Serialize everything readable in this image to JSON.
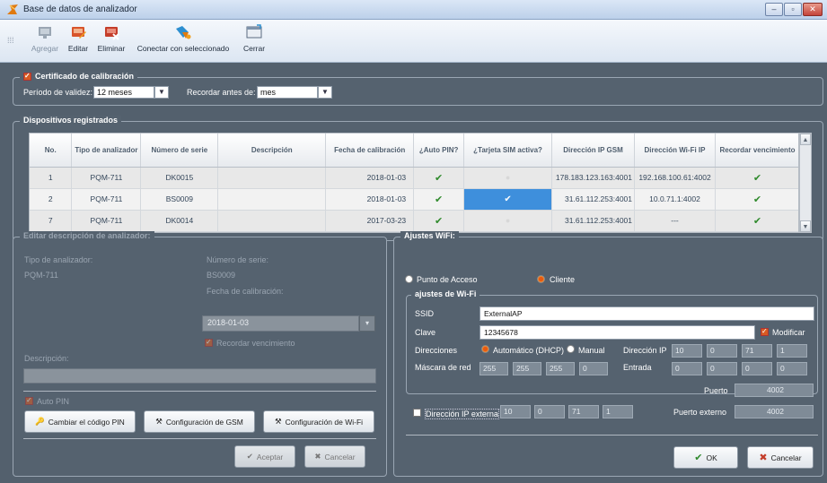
{
  "window": {
    "title": "Base de datos de analizador",
    "btn_min": "–",
    "btn_max": "▫",
    "btn_close": "✕"
  },
  "toolbar": {
    "agregar": "Agregar",
    "editar": "Editar",
    "eliminar": "Eliminar",
    "conectar": "Conectar con seleccionado",
    "cerrar": "Cerrar"
  },
  "calibration": {
    "title": "Certificado de calibración",
    "periodo_label": "Período de validez:",
    "periodo_value": "12 meses",
    "recordar_label": "Recordar antes de:",
    "recordar_value": "mes"
  },
  "devices": {
    "title": "Dispositivos registrados",
    "columns": [
      "No.",
      "Tipo de analizador",
      "Número de serie",
      "Descripción",
      "Fecha de calibración",
      "¿Auto PIN?",
      "¿Tarjeta SIM activa?",
      "Dirección IP GSM",
      "Dirección Wi-Fi IP",
      "Recordar vencimiento"
    ],
    "rows": [
      {
        "no": "1",
        "tipo": "PQM-711",
        "serie": "DK0015",
        "desc": "",
        "fecha": "2018-01-03",
        "gsm": "178.183.123.163:4001",
        "wifi": "192.168.100.61:4002"
      },
      {
        "no": "2",
        "tipo": "PQM-711",
        "serie": "BS0009",
        "desc": "",
        "fecha": "2018-01-03",
        "gsm": "31.61.112.253:4001",
        "wifi": "10.0.71.1:4002"
      },
      {
        "no": "7",
        "tipo": "PQM-711",
        "serie": "DK0014",
        "desc": "",
        "fecha": "2017-03-23",
        "gsm": "31.61.112.253:4001",
        "wifi": "---"
      }
    ]
  },
  "edit": {
    "title": "Editar descripción de analizador:",
    "tipo_label": "Tipo de analizador:",
    "tipo_value": "PQM-711",
    "serie_label": "Número de serie:",
    "serie_value": "BS0009",
    "fecha_label": "Fecha de calibración:",
    "fecha_value": "2018-01-03",
    "recordar": "Recordar vencimiento",
    "desc_label": "Descripción:",
    "autopin": "Auto PIN",
    "btn_pin": "Cambiar el código PIN",
    "btn_gsm": "Configuración de GSM",
    "btn_wifi": "Configuración de Wi-Fi",
    "btn_aceptar": "Aceptar",
    "btn_cancelar": "Cancelar"
  },
  "wifi": {
    "title": "Ajustes WiFi:",
    "punto": "Punto de Acceso",
    "cliente": "Cliente",
    "sub_title": "ajustes de Wi-Fi",
    "ssid_label": "SSID",
    "ssid_value": "ExternalAP",
    "clave_label": "Clave",
    "clave_value": "12345678",
    "modificar": "Modificar",
    "dir_label": "Direcciones",
    "auto": "Automático (DHCP)",
    "manual": "Manual",
    "ip_label": "Dirección IP",
    "ip": [
      "10",
      "0",
      "71",
      "1"
    ],
    "mask_label": "Máscara de red",
    "mask": [
      "255",
      "255",
      "255",
      "0"
    ],
    "gw_label": "Entrada",
    "gw": [
      "0",
      "0",
      "0",
      "0"
    ],
    "puerto_label": "Puerto",
    "puerto_value": "4002",
    "ext_label": "Dirección IP externa",
    "ext_ip": [
      "10",
      "0",
      "71",
      "1"
    ],
    "ext_port_label": "Puerto externo",
    "ext_port_value": "4002",
    "btn_ok": "OK",
    "btn_cancel": "Cancelar"
  }
}
